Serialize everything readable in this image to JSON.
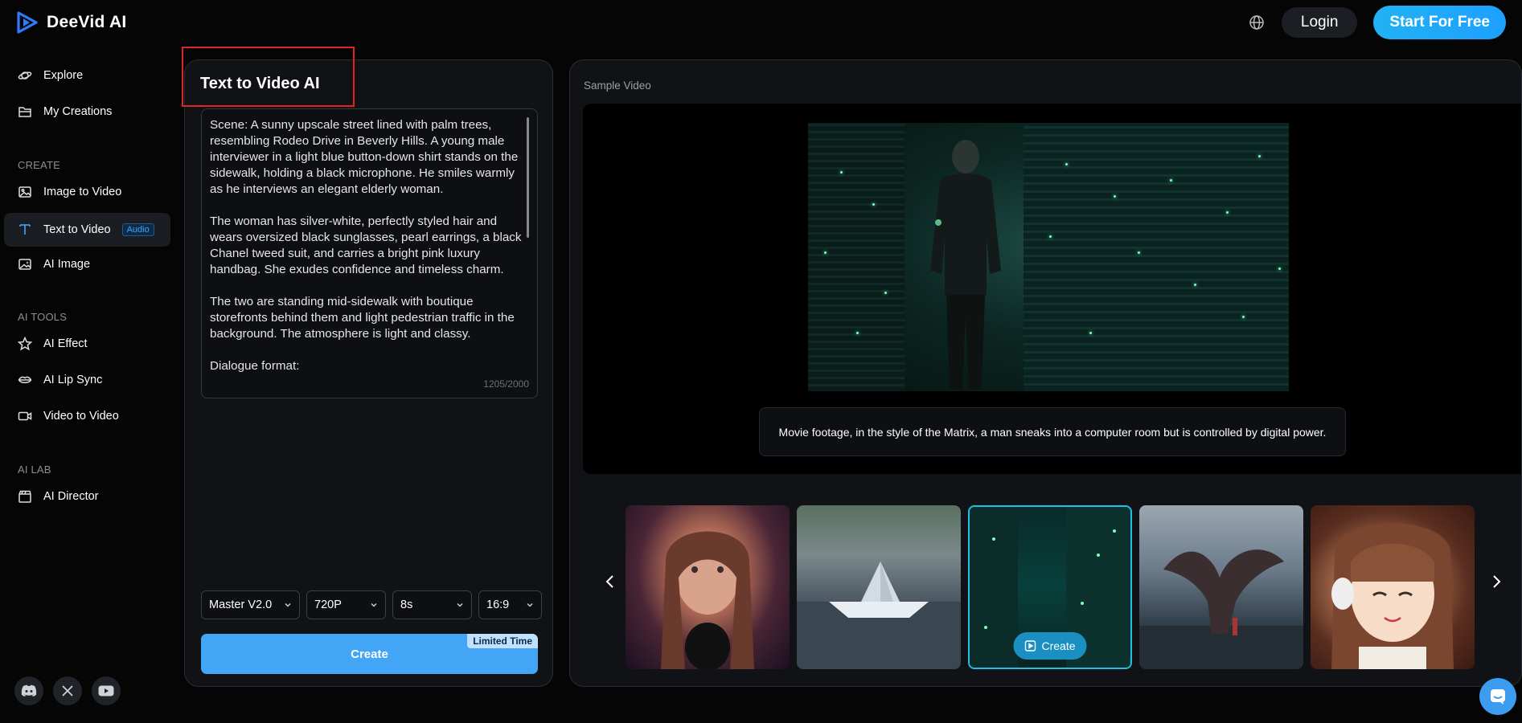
{
  "header": {
    "brand": "DeeVid AI",
    "login_label": "Login",
    "start_label": "Start For Free"
  },
  "sidebar": {
    "explore": "Explore",
    "my_creations": "My Creations",
    "section_create": "CREATE",
    "image_to_video": "Image to Video",
    "text_to_video": "Text to Video",
    "text_to_video_badge": "Audio",
    "ai_image": "AI Image",
    "section_tools": "AI TOOLS",
    "ai_effect": "AI Effect",
    "ai_lip_sync": "AI Lip Sync",
    "video_to_video": "Video to Video",
    "section_lab": "AI LAB",
    "ai_director": "AI Director"
  },
  "editor": {
    "title": "Text to Video AI",
    "prompt": "Scene: A sunny upscale street lined with palm trees, resembling Rodeo Drive in Beverly Hills. A young male interviewer in a light blue button-down shirt stands on the sidewalk, holding a black microphone. He smiles warmly as he interviews an elegant elderly woman.\n\nThe woman has silver-white, perfectly styled hair and wears oversized black sunglasses, pearl earrings, a black Chanel tweed suit, and carries a bright pink luxury handbag. She exudes confidence and timeless charm.\n\nThe two are standing mid-sidewalk with boutique storefronts behind them and light pedestrian traffic in the background. The atmosphere is light and classy.\n\nDialogue format:",
    "counter": "1205/2000",
    "model": "Master V2.0",
    "resolution": "720P",
    "duration": "8s",
    "ratio": "16:9",
    "create_label": "Create",
    "limited_label": "Limited Time"
  },
  "sample": {
    "label": "Sample Video",
    "caption": "Movie footage, in the style of the Matrix, a man sneaks into a computer room but is controlled by digital power.",
    "thumb_create_label": "Create"
  }
}
